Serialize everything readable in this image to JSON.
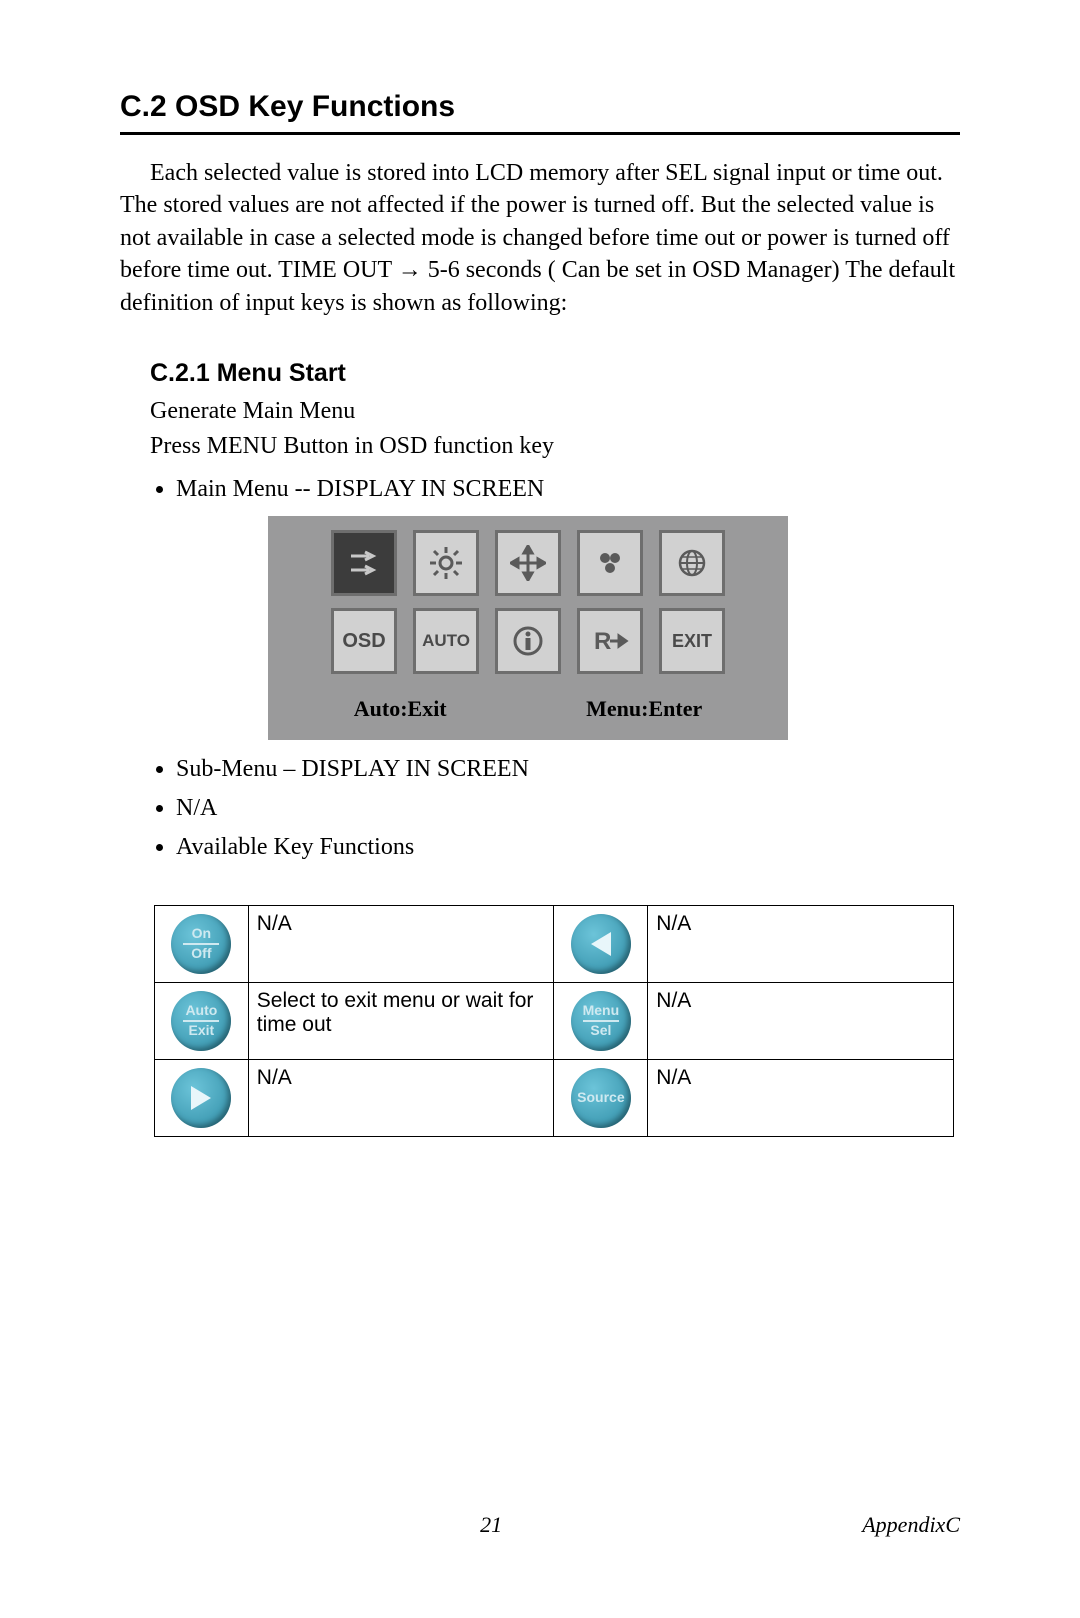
{
  "section": {
    "heading": "C.2  OSD Key Functions",
    "intro": "Each selected value is stored into LCD memory after SEL signal input or time out. The stored values are not affected if the power is turned off. But the selected value is not available in case a selected mode is changed before time out or power is turned off before time out. TIME OUT → 5-6 seconds ( Can be set in OSD Manager) The default definition of input keys is shown as following:"
  },
  "subsection": {
    "heading": "C.2.1 Menu Start",
    "line1": "Generate Main Menu",
    "line2": "Press MENU Button in OSD function key",
    "bullet_main": "Main Menu -- DISPLAY IN SCREEN",
    "bullet_sub": "Sub-Menu – DISPLAY IN SCREEN",
    "bullet_na": "N/A",
    "bullet_avail": "Available Key Functions"
  },
  "osd_panel": {
    "row1_icons": [
      "image-adjust",
      "brightness",
      "position",
      "color",
      "language"
    ],
    "row2_icons": [
      "OSD",
      "AUTO",
      "info",
      "recall",
      "EXIT"
    ],
    "hint_left": "Auto:Exit",
    "hint_right": "Menu:Enter"
  },
  "key_table": {
    "rows": [
      {
        "btn1_name": "on-off-button",
        "btn1_label_top": "On",
        "btn1_label_bot": "Off",
        "desc1": "N/A",
        "btn2_name": "left-arrow-button",
        "btn2_shape": "tri-left",
        "desc2": "N/A"
      },
      {
        "btn1_name": "auto-exit-button",
        "btn1_label_top": "Auto",
        "btn1_label_bot": "Exit",
        "desc1": "Select to exit menu or wait for time out",
        "btn2_name": "menu-sel-button",
        "btn2_label_top": "Menu",
        "btn2_label_bot": "Sel",
        "desc2": "N/A"
      },
      {
        "btn1_name": "right-arrow-button",
        "btn1_shape": "tri-right",
        "desc1": "N/A",
        "btn2_name": "source-button",
        "btn2_label_single": "Source",
        "desc2": "N/A"
      }
    ]
  },
  "footer": {
    "page_number": "21",
    "appendix": "AppendixC"
  }
}
